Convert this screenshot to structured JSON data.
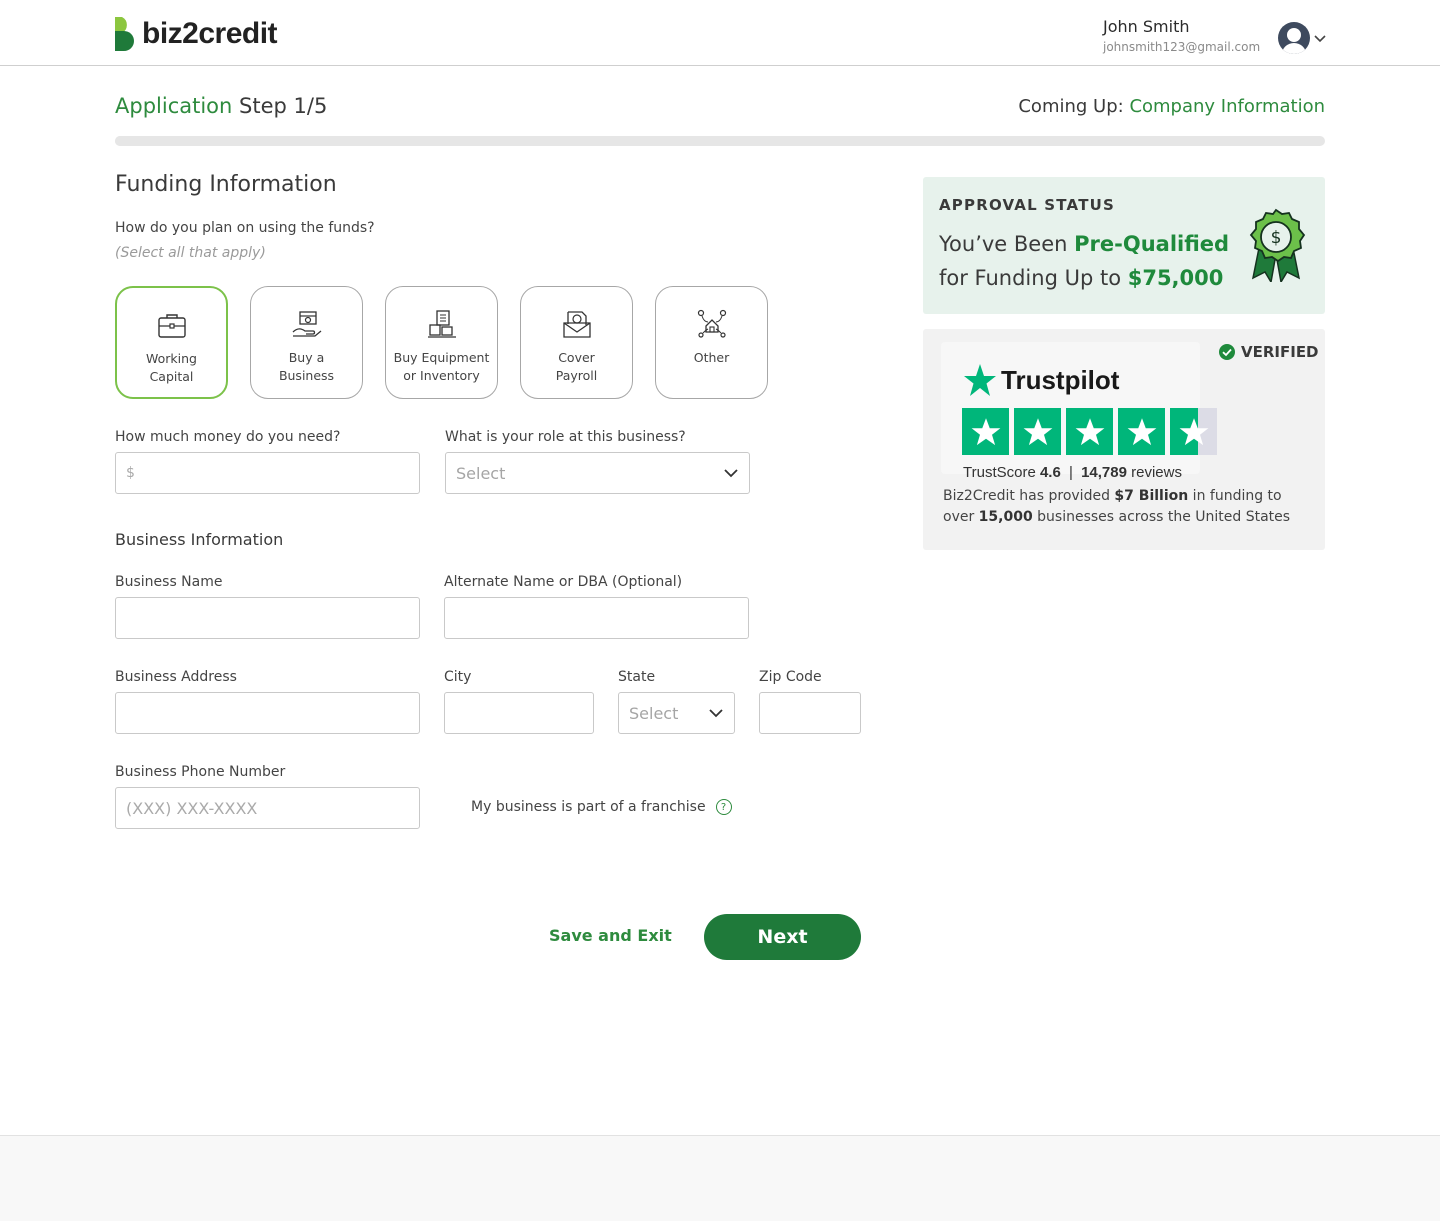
{
  "brand": {
    "name": "biz2credit",
    "green": "#2e8b3e",
    "dark_green": "#1f7a3a"
  },
  "user": {
    "name": "John Smith",
    "email": "johnsmith123@gmail.com"
  },
  "progress": {
    "prefix": "Application",
    "step": "Step 1/5",
    "coming_up_label": "Coming Up:",
    "coming_up_value": "Company Information",
    "fraction": 0.2
  },
  "funding": {
    "title": "Funding Information",
    "question": "How do you plan on using the funds?",
    "hint": "(Select all that apply)",
    "options": [
      {
        "label": "Working\nCapital",
        "icon": "briefcase-icon",
        "selected": true
      },
      {
        "label": "Buy a\nBusiness",
        "icon": "storefront-icon",
        "selected": false
      },
      {
        "label": "Buy Equipment\nor Inventory",
        "icon": "equipment-icon",
        "selected": false
      },
      {
        "label": "Cover\nPayroll",
        "icon": "payroll-icon",
        "selected": false
      },
      {
        "label": "Other",
        "icon": "other-icon",
        "selected": false
      }
    ],
    "amount_label": "How much money do you need?",
    "amount_placeholder": "$",
    "role_label": "What is your role at this business?",
    "role_value": "Select"
  },
  "business": {
    "title": "Business Information",
    "name_label": "Business Name",
    "dba_label": "Alternate Name or DBA (Optional)",
    "address_label": "Business Address",
    "city_label": "City",
    "state_label": "State",
    "state_value": "Select",
    "zip_label": "Zip Code",
    "phone_label": "Business Phone Number",
    "phone_placeholder": "(XXX) XXX-XXXX",
    "franchise_label": "My business is part of a franchise",
    "franchise_help": "?"
  },
  "actions": {
    "save_exit": "Save and Exit",
    "next": "Next"
  },
  "approval": {
    "title": "APPROVAL STATUS",
    "line1_pre": "You’ve Been ",
    "line1_highlight": "Pre-Qualified",
    "line2_pre": "for Funding Up to ",
    "line2_amount": "$75,000"
  },
  "trustpilot": {
    "logo": "Trustpilot",
    "verified": "VERIFIED",
    "score_label": "TrustScore",
    "score": "4.6",
    "separator": "|",
    "reviews": "14,789",
    "reviews_label": "reviews",
    "rating": 4.6,
    "text_1": "Biz2Credit has provided ",
    "text_b1": "$7 Billion",
    "text_2": " in funding to over ",
    "text_b2": "15,000",
    "text_3": " businesses across the United States"
  }
}
